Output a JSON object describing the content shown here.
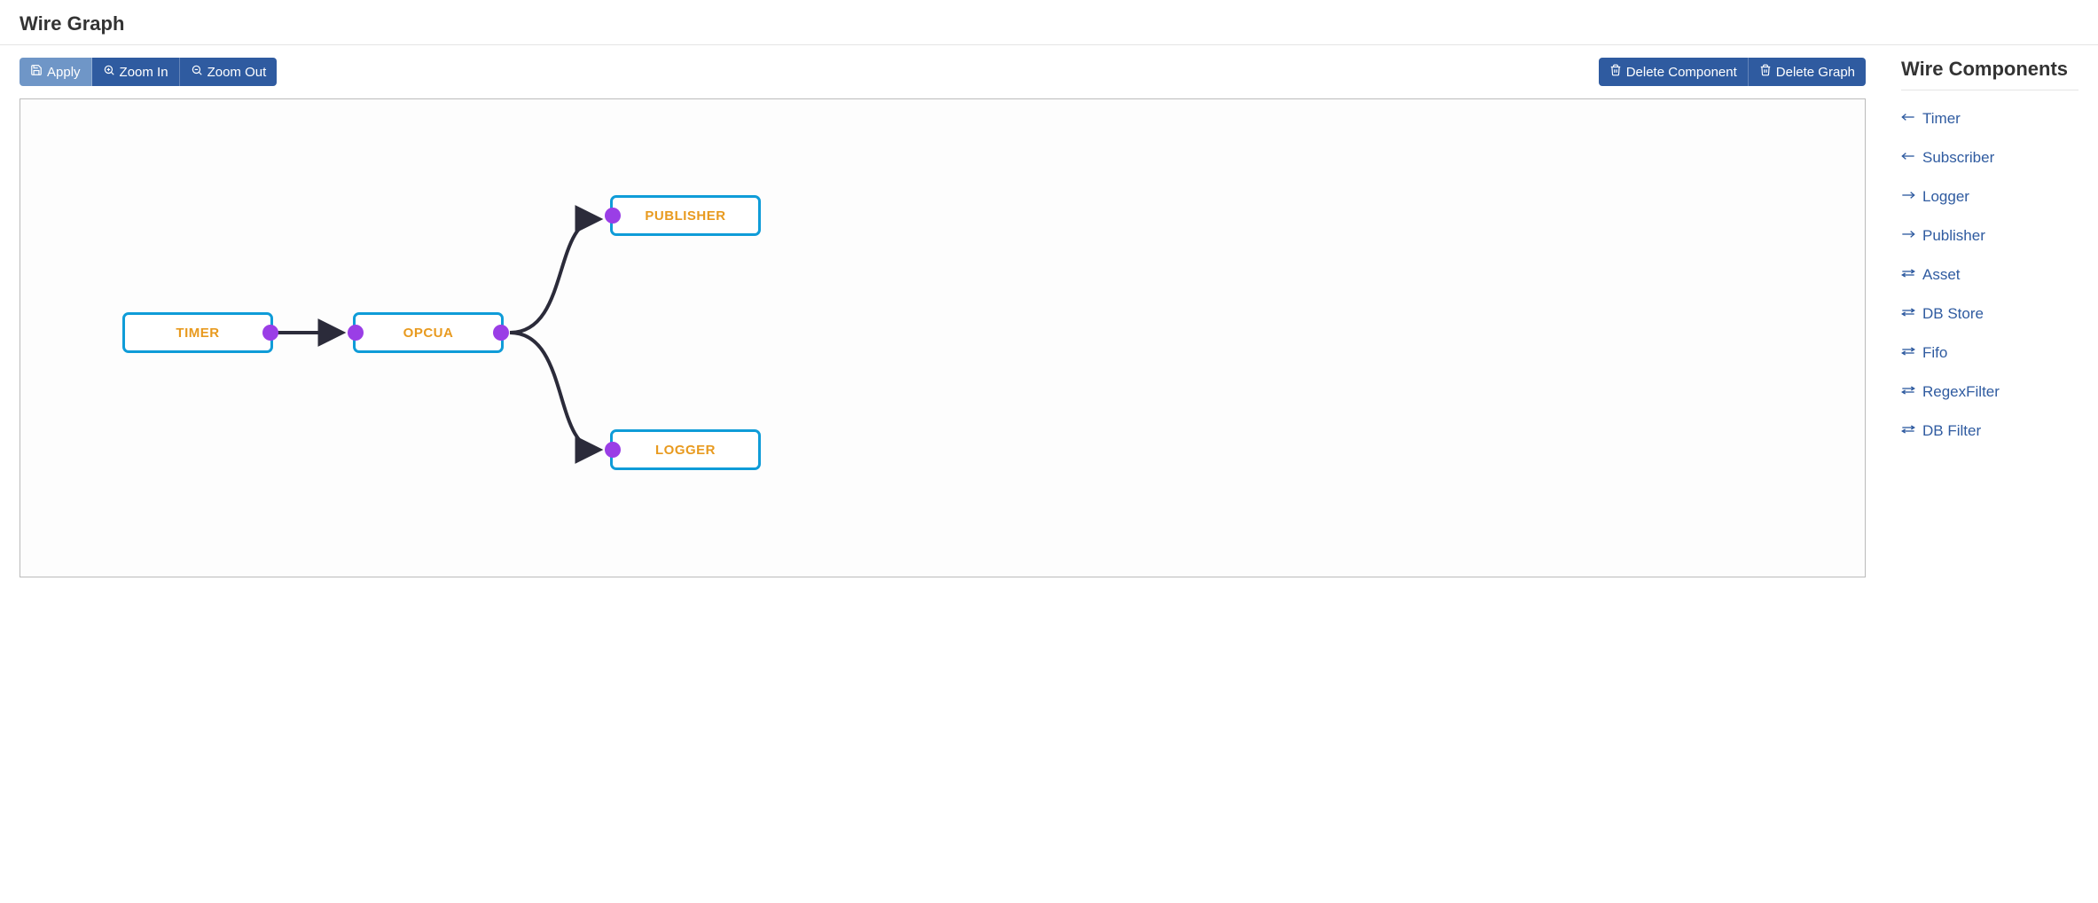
{
  "page_title": "Wire Graph",
  "toolbar": {
    "apply": "Apply",
    "zoom_in": "Zoom In",
    "zoom_out": "Zoom Out",
    "delete_component": "Delete Component",
    "delete_graph": "Delete Graph"
  },
  "nodes": {
    "timer": "TIMER",
    "opcua": "OPCUA",
    "publisher": "PUBLISHER",
    "logger": "LOGGER"
  },
  "sidebar": {
    "title": "Wire Components",
    "items": [
      {
        "label": "Timer",
        "icon": "arrow-left"
      },
      {
        "label": "Subscriber",
        "icon": "arrow-left"
      },
      {
        "label": "Logger",
        "icon": "arrow-right"
      },
      {
        "label": "Publisher",
        "icon": "arrow-right"
      },
      {
        "label": "Asset",
        "icon": "bidir"
      },
      {
        "label": "DB Store",
        "icon": "bidir"
      },
      {
        "label": "Fifo",
        "icon": "bidir"
      },
      {
        "label": "RegexFilter",
        "icon": "bidir"
      },
      {
        "label": "DB Filter",
        "icon": "bidir"
      }
    ]
  }
}
